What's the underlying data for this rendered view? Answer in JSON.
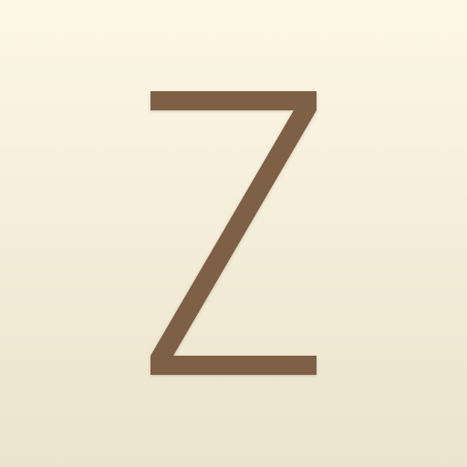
{
  "icon": {
    "logo_letter": "Z",
    "colors": {
      "background_top": "#fdf7e5",
      "background_bottom": "#ebe3cd",
      "letter": "#7e6147"
    }
  }
}
